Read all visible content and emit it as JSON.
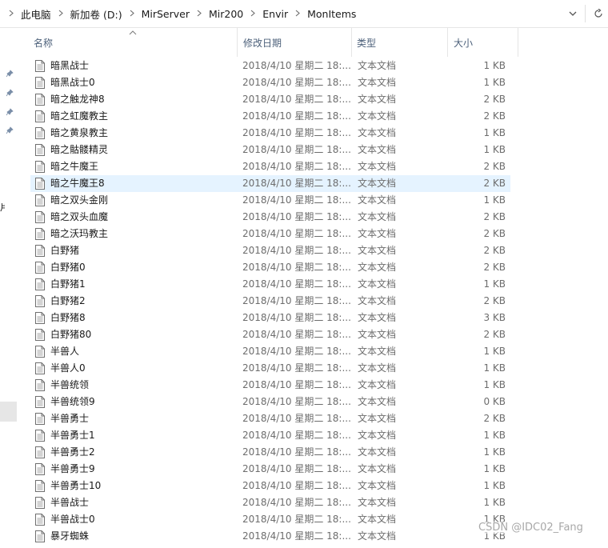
{
  "breadcrumb": [
    "此电脑",
    "新加卷 (D:)",
    "MirServer",
    "Mir200",
    "Envir",
    "MonItems"
  ],
  "columns": {
    "name": "名称",
    "date": "修改日期",
    "type": "类型",
    "size": "大小"
  },
  "rows": [
    {
      "name": "暗黑战士",
      "date": "2018/4/10 星期二 18:...",
      "type": "文本文档",
      "size": "1 KB"
    },
    {
      "name": "暗黑战士0",
      "date": "2018/4/10 星期二 18:...",
      "type": "文本文档",
      "size": "1 KB"
    },
    {
      "name": "暗之触龙神8",
      "date": "2018/4/10 星期二 18:...",
      "type": "文本文档",
      "size": "2 KB"
    },
    {
      "name": "暗之虹魔教主",
      "date": "2018/4/10 星期二 18:...",
      "type": "文本文档",
      "size": "2 KB"
    },
    {
      "name": "暗之黄泉教主",
      "date": "2018/4/10 星期二 18:...",
      "type": "文本文档",
      "size": "1 KB"
    },
    {
      "name": "暗之骷髅精灵",
      "date": "2018/4/10 星期二 18:...",
      "type": "文本文档",
      "size": "1 KB"
    },
    {
      "name": "暗之牛魔王",
      "date": "2018/4/10 星期二 18:...",
      "type": "文本文档",
      "size": "2 KB"
    },
    {
      "name": "暗之牛魔王8",
      "date": "2018/4/10 星期二 18:...",
      "type": "文本文档",
      "size": "2 KB",
      "selected": true
    },
    {
      "name": "暗之双头金刚",
      "date": "2018/4/10 星期二 18:...",
      "type": "文本文档",
      "size": "1 KB"
    },
    {
      "name": "暗之双头血魔",
      "date": "2018/4/10 星期二 18:...",
      "type": "文本文档",
      "size": "2 KB"
    },
    {
      "name": "暗之沃玛教主",
      "date": "2018/4/10 星期二 18:...",
      "type": "文本文档",
      "size": "2 KB"
    },
    {
      "name": "白野猪",
      "date": "2018/4/10 星期二 18:...",
      "type": "文本文档",
      "size": "2 KB"
    },
    {
      "name": "白野猪0",
      "date": "2018/4/10 星期二 18:...",
      "type": "文本文档",
      "size": "2 KB"
    },
    {
      "name": "白野猪1",
      "date": "2018/4/10 星期二 18:...",
      "type": "文本文档",
      "size": "1 KB"
    },
    {
      "name": "白野猪2",
      "date": "2018/4/10 星期二 18:...",
      "type": "文本文档",
      "size": "2 KB"
    },
    {
      "name": "白野猪8",
      "date": "2018/4/10 星期二 18:...",
      "type": "文本文档",
      "size": "3 KB"
    },
    {
      "name": "白野猪80",
      "date": "2018/4/10 星期二 18:...",
      "type": "文本文档",
      "size": "2 KB"
    },
    {
      "name": "半兽人",
      "date": "2018/4/10 星期二 18:...",
      "type": "文本文档",
      "size": "1 KB"
    },
    {
      "name": "半兽人0",
      "date": "2018/4/10 星期二 18:...",
      "type": "文本文档",
      "size": "1 KB"
    },
    {
      "name": "半兽统领",
      "date": "2018/4/10 星期二 18:...",
      "type": "文本文档",
      "size": "1 KB"
    },
    {
      "name": "半兽统领9",
      "date": "2018/4/10 星期二 18:...",
      "type": "文本文档",
      "size": "0 KB"
    },
    {
      "name": "半兽勇士",
      "date": "2018/4/10 星期二 18:...",
      "type": "文本文档",
      "size": "2 KB"
    },
    {
      "name": "半兽勇士1",
      "date": "2018/4/10 星期二 18:...",
      "type": "文本文档",
      "size": "1 KB"
    },
    {
      "name": "半兽勇士2",
      "date": "2018/4/10 星期二 18:...",
      "type": "文本文档",
      "size": "1 KB"
    },
    {
      "name": "半兽勇士9",
      "date": "2018/4/10 星期二 18:...",
      "type": "文本文档",
      "size": "1 KB"
    },
    {
      "name": "半兽勇士10",
      "date": "2018/4/10 星期二 18:...",
      "type": "文本文档",
      "size": "1 KB"
    },
    {
      "name": "半兽战士",
      "date": "2018/4/10 星期二 18:...",
      "type": "文本文档",
      "size": "1 KB"
    },
    {
      "name": "半兽战士0",
      "date": "2018/4/10 星期二 18:...",
      "type": "文本文档",
      "size": "1 KB"
    },
    {
      "name": "暴牙蜘蛛",
      "date": "2018/4/10 星期二 18:...",
      "type": "文本文档",
      "size": "1 KB"
    }
  ],
  "nav_glyph": "片",
  "watermark": "CSDN @IDC02_Fang",
  "icons": {
    "address_dropdown": "chevron-down-icon",
    "refresh": "refresh-icon",
    "pin": "pin-icon",
    "file": "text-file-icon",
    "sort": "sort-ascending-icon"
  },
  "colors": {
    "selected_row": "#e5f3ff",
    "header_text": "#4c607a",
    "muted_text": "#6d6d6d"
  }
}
